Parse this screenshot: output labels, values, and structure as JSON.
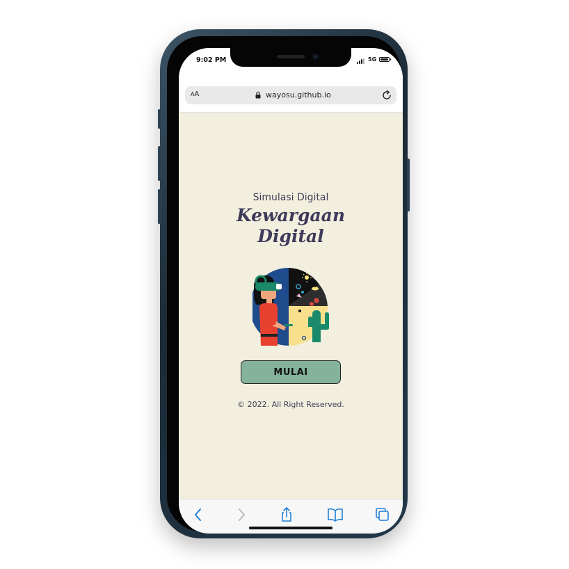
{
  "status_bar": {
    "time": "9:02 PM",
    "network": "5G"
  },
  "browser": {
    "text_size_small": "A",
    "text_size_large": "A",
    "url": "wayosu.github.io",
    "icons": {
      "lock": "lock-icon",
      "reload": "reload-icon"
    }
  },
  "page": {
    "subtitle": "Simulasi Digital",
    "title_line1": "Kewargaan",
    "title_line2": "Digital",
    "start_button": "MULAI",
    "copyright": "© 2022. All Right Reserved."
  },
  "toolbar": {
    "icons": [
      "back-icon",
      "forward-icon",
      "share-icon",
      "bookmarks-icon",
      "tabs-icon"
    ]
  },
  "colors": {
    "page_bg": "#f2efdf",
    "title": "#3d3a5a",
    "button_bg": "#84b29a",
    "accent_blue": "#1e7fd6"
  }
}
